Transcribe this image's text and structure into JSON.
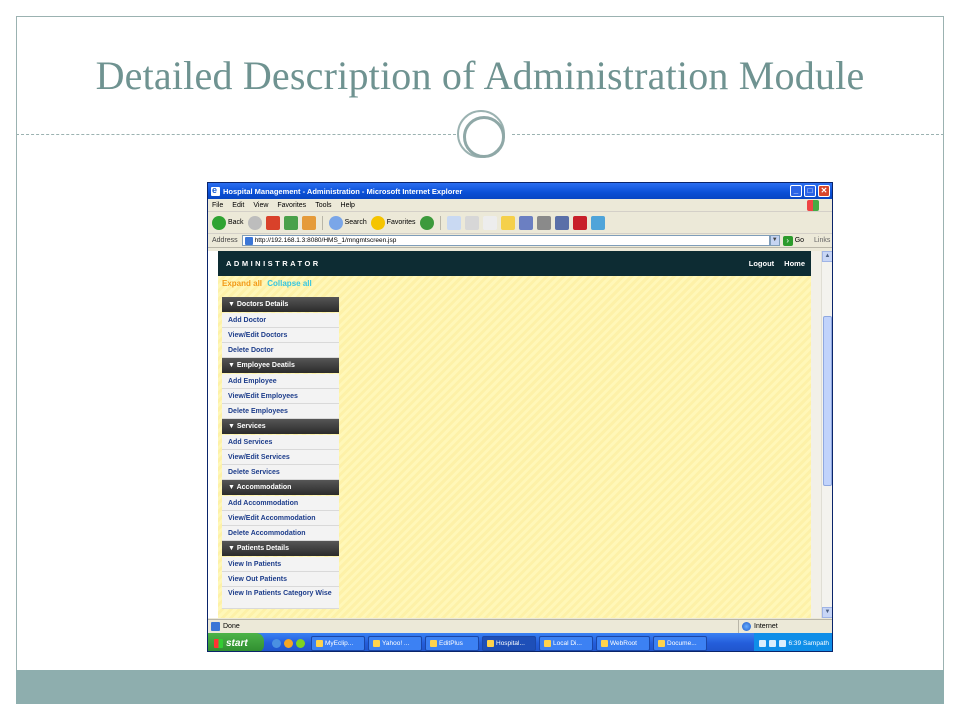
{
  "slide": {
    "title": "Detailed Description of Administration Module"
  },
  "window": {
    "title": "Hospital Management - Administration - Microsoft Internet Explorer",
    "controls": {
      "minimize": "_",
      "maximize": "□",
      "close": "✕"
    }
  },
  "menubar": [
    "File",
    "Edit",
    "View",
    "Favorites",
    "Tools",
    "Help"
  ],
  "toolbar": {
    "back_label": "Back",
    "search_label": "Search",
    "favorites_label": "Favorites"
  },
  "address": {
    "label": "Address",
    "url": "http://192.168.1.3:8080/HMS_1/mngmtscreen.jsp",
    "go_label": "Go",
    "links_label": "Links"
  },
  "page": {
    "header_title": "ADMINISTRATOR",
    "logout_label": "Logout",
    "home_label": "Home",
    "expand_all": "Expand all",
    "collapse_all": "Collapse all",
    "menu": [
      {
        "heading": "▼ Doctors Details",
        "items": [
          "Add Doctor",
          "View/Edit Doctors",
          "Delete Doctor"
        ]
      },
      {
        "heading": "▼ Employee Deatils",
        "items": [
          "Add Employee",
          "View/Edit Employees",
          "Delete Employees"
        ]
      },
      {
        "heading": "▼ Services",
        "items": [
          "Add Services",
          "View/Edit Services",
          "Delete Services"
        ]
      },
      {
        "heading": "▼ Accommodation",
        "items": [
          "Add Accommodation",
          "View/Edit Accommodation",
          "Delete Accommodation"
        ]
      },
      {
        "heading": "▼ Patients Details",
        "items": [
          "View In Patients",
          "View Out Patients",
          "View In Patients Category Wise"
        ]
      }
    ]
  },
  "statusbar": {
    "status": "Done",
    "zone": "Internet"
  },
  "taskbar": {
    "start_label": "start",
    "tasks": [
      "MyEclip...",
      "Yahoo! ...",
      "EditPlus",
      "Hospital...",
      "Local Di...",
      "WebRoot",
      "Docume..."
    ],
    "clock": "6:39 Sampath"
  }
}
